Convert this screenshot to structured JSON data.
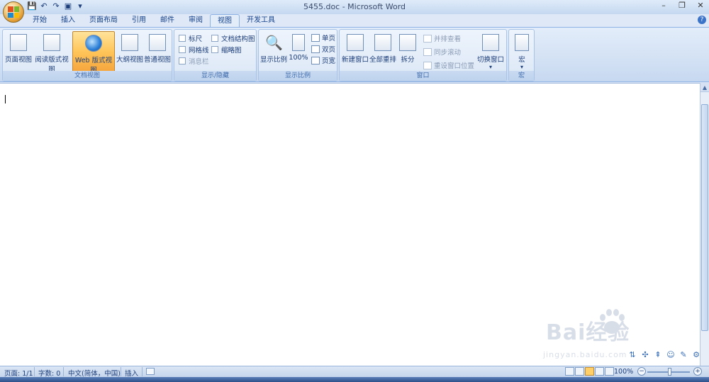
{
  "window": {
    "title": "5455.doc - Microsoft Word",
    "controls": {
      "minimize": "–",
      "restore": "❐",
      "close": "✕"
    }
  },
  "qat": {
    "save": "💾",
    "undo": "↶",
    "redo": "↷",
    "preview": "▣",
    "more": "▾"
  },
  "tabs": [
    {
      "label": "开始"
    },
    {
      "label": "插入"
    },
    {
      "label": "页面布局"
    },
    {
      "label": "引用"
    },
    {
      "label": "邮件"
    },
    {
      "label": "审阅"
    },
    {
      "label": "视图"
    },
    {
      "label": "开发工具"
    }
  ],
  "active_tab": "视图",
  "ribbon": {
    "doc_views": {
      "label": "文档视图",
      "buttons": [
        {
          "label": "页面视图"
        },
        {
          "label": "阅读版式视图"
        },
        {
          "label": "Web 版式视图"
        },
        {
          "label": "大纲视图"
        },
        {
          "label": "普通视图"
        }
      ],
      "active": "Web 版式视图"
    },
    "show_hide": {
      "label": "显示/隐藏",
      "items": [
        {
          "label": "标尺",
          "checked": false,
          "enabled": true
        },
        {
          "label": "网格线",
          "checked": false,
          "enabled": true
        },
        {
          "label": "消息栏",
          "checked": false,
          "enabled": false
        },
        {
          "label": "文档结构图",
          "checked": false,
          "enabled": true
        },
        {
          "label": "缩略图",
          "checked": false,
          "enabled": true
        }
      ]
    },
    "zoom": {
      "label": "显示比例",
      "zoom_button": "显示比例",
      "hundred_button": "100%",
      "single_page": "单页",
      "two_pages": "双页",
      "page_width": "页宽"
    },
    "window": {
      "label": "窗口",
      "new_window": "新建窗口",
      "arrange_all": "全部重排",
      "split": "拆分",
      "side_by_side": "并排查看",
      "sync_scroll": "同步滚动",
      "reset_position": "重设窗口位置",
      "switch_windows": "切换窗口"
    },
    "macros": {
      "label": "宏",
      "button": "宏"
    }
  },
  "statusbar": {
    "page": "页面: 1/1",
    "words": "字数: 0",
    "language": "中文(简体，中国)",
    "mode": "插入",
    "zoom": "100%"
  },
  "watermark": {
    "text": "Bai经验",
    "url": "jingyan.baidu.com"
  }
}
